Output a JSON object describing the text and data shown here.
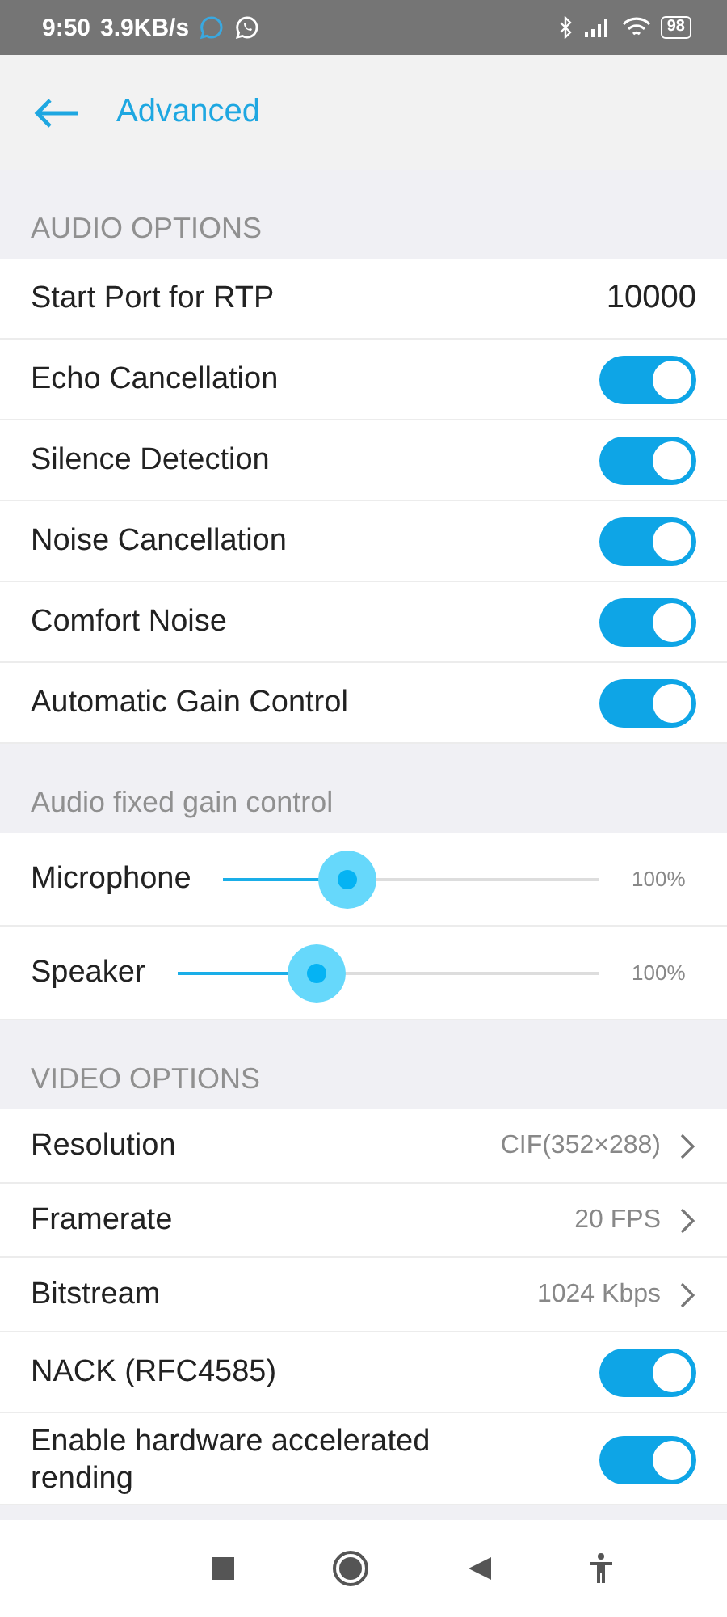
{
  "status_bar": {
    "time": "9:50",
    "speed": "3.9KB/s",
    "battery": "98"
  },
  "header": {
    "title": "Advanced"
  },
  "sections": [
    {
      "title": "AUDIO OPTIONS",
      "items": [
        {
          "kind": "value",
          "label": "Start Port for RTP",
          "value": "10000"
        },
        {
          "kind": "switch",
          "label": "Echo Cancellation",
          "on": true
        },
        {
          "kind": "switch",
          "label": "Silence Detection",
          "on": true
        },
        {
          "kind": "switch",
          "label": "Noise Cancellation",
          "on": true
        },
        {
          "kind": "switch",
          "label": "Comfort Noise",
          "on": true
        },
        {
          "kind": "switch",
          "label": "Automatic Gain Control",
          "on": true
        }
      ]
    },
    {
      "title": "Audio fixed gain control",
      "items": [
        {
          "kind": "slider",
          "label": "Microphone",
          "level": 0.33,
          "reading": "100%"
        },
        {
          "kind": "slider",
          "label": "Speaker",
          "level": 0.33,
          "reading": "100%"
        }
      ]
    },
    {
      "title": "VIDEO OPTIONS",
      "items": [
        {
          "kind": "choice",
          "label": "Resolution",
          "value": "CIF(352×288)"
        },
        {
          "kind": "choice",
          "label": "Framerate",
          "value": "20 FPS"
        },
        {
          "kind": "choice",
          "label": "Bitstream",
          "value": "1024 Kbps"
        },
        {
          "kind": "switch",
          "label": "NACK (RFC4585)",
          "on": true
        },
        {
          "kind": "switch",
          "label": "Enable hardware accelerated rending",
          "on": true
        }
      ]
    }
  ]
}
